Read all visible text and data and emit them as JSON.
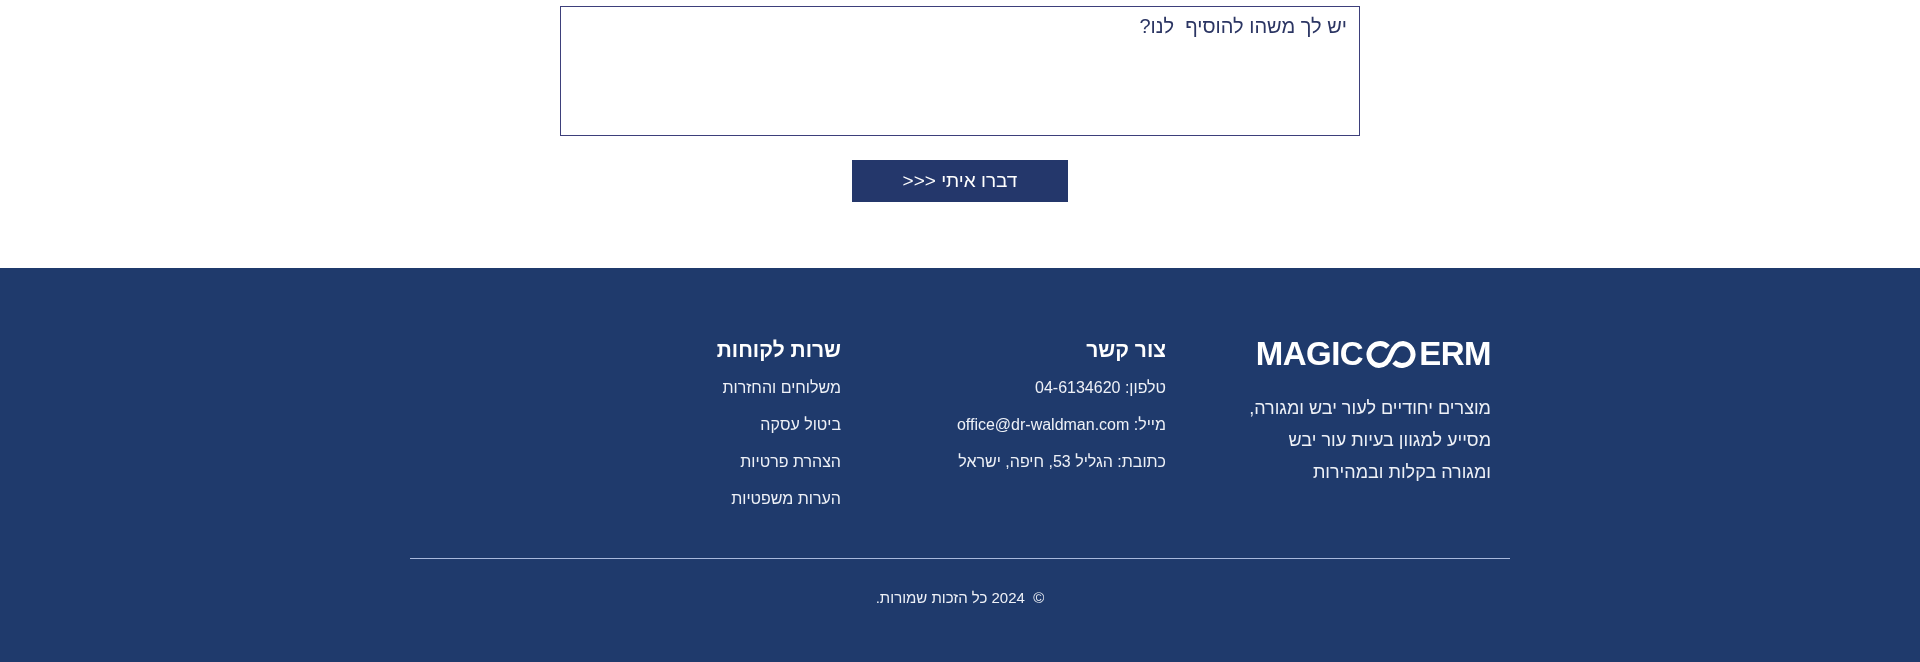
{
  "form": {
    "message_field": {
      "placeholder": "יש לך משהו להוסיף  לנו?"
    },
    "submit_button": {
      "label": ">>> דברו איתי"
    }
  },
  "footer": {
    "brand": {
      "logo_lead": "MAGIC",
      "logo_tail": "ERM",
      "description_lines": [
        "מוצרים יחודיים לעור יבש ומגורה,",
        "מסייע למגוון בעיות עור יבש",
        "ומגורה בקלות ובמהירות"
      ]
    },
    "columns": [
      {
        "heading": "צור קשר",
        "items": [
          "טלפון: 04-6134620",
          "מייל: office@dr-waldman.com",
          "כתובת: הגליל 53, חיפה, ישראל"
        ]
      },
      {
        "heading": "שרות לקוחות",
        "items": [
          "משלוחים והחזרות",
          "ביטול עסקה",
          "הצהרת פרטיות",
          "הערות משפטיות"
        ]
      }
    ],
    "copyright": "©  2024 כל הזכות שמורות."
  }
}
